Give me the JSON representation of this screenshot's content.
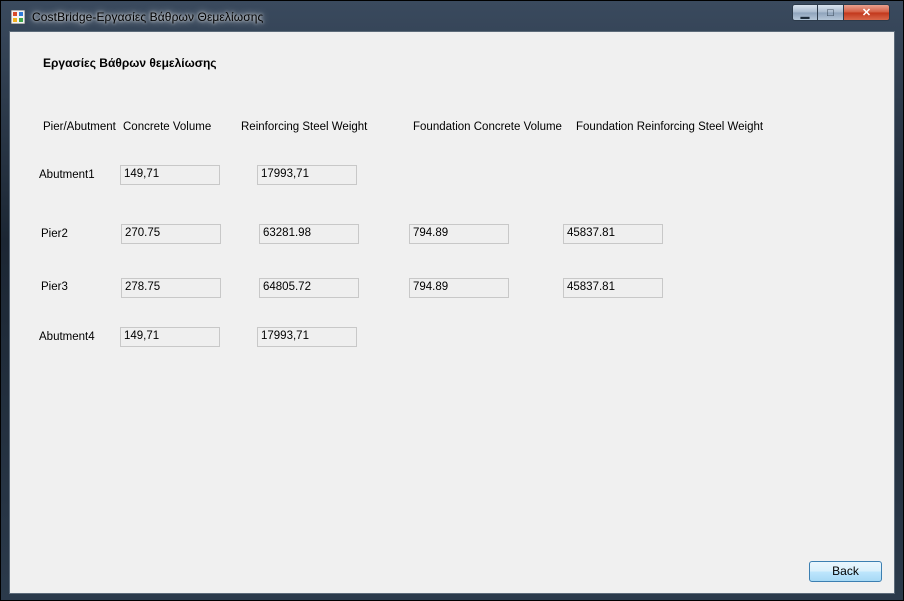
{
  "window": {
    "title": "CostBridge-Εργασίες Βάθρων Θεμελίωσης",
    "controls": {
      "minimize": "▁",
      "maximize": "□",
      "close": "✕"
    }
  },
  "form": {
    "heading": "Εργασίες Βάθρων θεμελίωσης",
    "columns": {
      "pier": "Pier/Abutment",
      "concrete": "Concrete Volume",
      "steel": "Reinforcing Steel Weight",
      "found_concrete": "Foundation Concrete Volume",
      "found_steel": "Foundation Reinforcing Steel Weight"
    },
    "rows": [
      {
        "name": "Abutment1",
        "concrete": "149,71",
        "steel": "17993,71"
      },
      {
        "name": "Pier2",
        "concrete": "270.75",
        "steel": "63281.98",
        "found_concrete": "794.89",
        "found_steel": "45837.81"
      },
      {
        "name": "Pier3",
        "concrete": "278.75",
        "steel": "64805.72",
        "found_concrete": "794.89",
        "found_steel": "45837.81"
      },
      {
        "name": "Abutment4",
        "concrete": "149,71",
        "steel": "17993,71"
      }
    ],
    "back_label": "Back"
  }
}
